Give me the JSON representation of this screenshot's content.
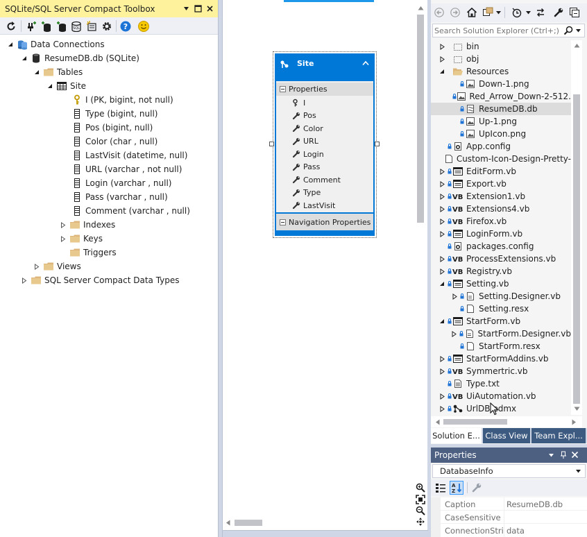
{
  "toolbox": {
    "title": "SQLite/SQL Server Compact Toolbox",
    "tree": {
      "root": "Data Connections",
      "db": "ResumeDB.db (SQLite)",
      "tables": "Tables",
      "table": "Site",
      "columns": [
        "I (PK, bigint, not null)",
        "Type (bigint, null)",
        "Pos (bigint, null)",
        "Color (char , null)",
        "LastVisit (datetime, null)",
        "URL (varchar , not null)",
        "Login (varchar , null)",
        "Pass (varchar , null)",
        "Comment (varchar , null)"
      ],
      "indexes": "Indexes",
      "keys": "Keys",
      "triggers": "Triggers",
      "views": "Views",
      "types": "SQL Server Compact Data Types"
    }
  },
  "designer": {
    "entity_title": "Site",
    "properties_header": "Properties",
    "properties": [
      "I",
      "Pos",
      "Color",
      "URL",
      "Login",
      "Pass",
      "Comment",
      "Type",
      "LastVisit"
    ],
    "nav_header": "Navigation Properties"
  },
  "solution": {
    "search_placeholder": "Search Solution Explorer (Ctrl+;)",
    "items": [
      {
        "label": "bin",
        "indent": 0,
        "exp": "collapsed",
        "icon": "folder-outline"
      },
      {
        "label": "obj",
        "indent": 0,
        "exp": "collapsed",
        "icon": "folder-outline"
      },
      {
        "label": "Resources",
        "indent": 0,
        "exp": "expanded",
        "icon": "folder-open"
      },
      {
        "label": "Down-1.png",
        "indent": 1,
        "exp": "",
        "icon": "image"
      },
      {
        "label": "Red_Arrow_Down-2-512.",
        "indent": 1,
        "exp": "",
        "icon": "image"
      },
      {
        "label": "ResumeDB.db",
        "indent": 1,
        "exp": "",
        "icon": "db-file",
        "selected": true
      },
      {
        "label": "Up-1.png",
        "indent": 1,
        "exp": "",
        "icon": "image"
      },
      {
        "label": "UpIcon.png",
        "indent": 1,
        "exp": "",
        "icon": "image"
      },
      {
        "label": "App.config",
        "indent": 0,
        "exp": "",
        "icon": "config"
      },
      {
        "label": "Custom-Icon-Design-Pretty-",
        "indent": 0,
        "exp": "",
        "icon": "file"
      },
      {
        "label": "EditForm.vb",
        "indent": 0,
        "exp": "collapsed",
        "icon": "form"
      },
      {
        "label": "Export.vb",
        "indent": 0,
        "exp": "collapsed",
        "icon": "form"
      },
      {
        "label": "Extension1.vb",
        "indent": 0,
        "exp": "collapsed",
        "icon": "vb"
      },
      {
        "label": "Extensions4.vb",
        "indent": 0,
        "exp": "collapsed",
        "icon": "vb"
      },
      {
        "label": "Firefox.vb",
        "indent": 0,
        "exp": "collapsed",
        "icon": "vb"
      },
      {
        "label": "LoginForm.vb",
        "indent": 0,
        "exp": "collapsed",
        "icon": "form"
      },
      {
        "label": "packages.config",
        "indent": 0,
        "exp": "",
        "icon": "config"
      },
      {
        "label": "ProcessExtensions.vb",
        "indent": 0,
        "exp": "collapsed",
        "icon": "vb"
      },
      {
        "label": "Registry.vb",
        "indent": 0,
        "exp": "collapsed",
        "icon": "vb"
      },
      {
        "label": "Setting.vb",
        "indent": 0,
        "exp": "expanded",
        "icon": "form"
      },
      {
        "label": "Setting.Designer.vb",
        "indent": 1,
        "exp": "collapsed",
        "icon": "designer"
      },
      {
        "label": "Setting.resx",
        "indent": 1,
        "exp": "",
        "icon": "resx"
      },
      {
        "label": "StartForm.vb",
        "indent": 0,
        "exp": "expanded",
        "icon": "form"
      },
      {
        "label": "StartForm.Designer.vb",
        "indent": 1,
        "exp": "collapsed",
        "icon": "designer"
      },
      {
        "label": "StartForm.resx",
        "indent": 1,
        "exp": "",
        "icon": "resx"
      },
      {
        "label": "StartFormAddins.vb",
        "indent": 0,
        "exp": "collapsed",
        "icon": "form"
      },
      {
        "label": "Symmertric.vb",
        "indent": 0,
        "exp": "collapsed",
        "icon": "vb"
      },
      {
        "label": "Type.txt",
        "indent": 0,
        "exp": "",
        "icon": "txt"
      },
      {
        "label": "UiAutomation.vb",
        "indent": 0,
        "exp": "collapsed",
        "icon": "vb"
      },
      {
        "label": "UrlDB.edmx",
        "indent": 0,
        "exp": "collapsed",
        "icon": "edmx"
      }
    ],
    "tabs": [
      "Solution E...",
      "Class View",
      "Team Expl..."
    ]
  },
  "properties_panel": {
    "title": "Properties",
    "object": "DatabaseInfo",
    "rows": [
      {
        "name": "Caption",
        "value": "ResumeDB.db"
      },
      {
        "name": "CaseSensitive",
        "value": ""
      },
      {
        "name": "ConnectionStrin",
        "value": "data source=E:\\Resu"
      }
    ]
  },
  "colors": {
    "accent_yellow": "#fff29d",
    "entity_blue": "#0078d7",
    "selection": "#dcdcdc",
    "frame": "#cfd6e5"
  }
}
